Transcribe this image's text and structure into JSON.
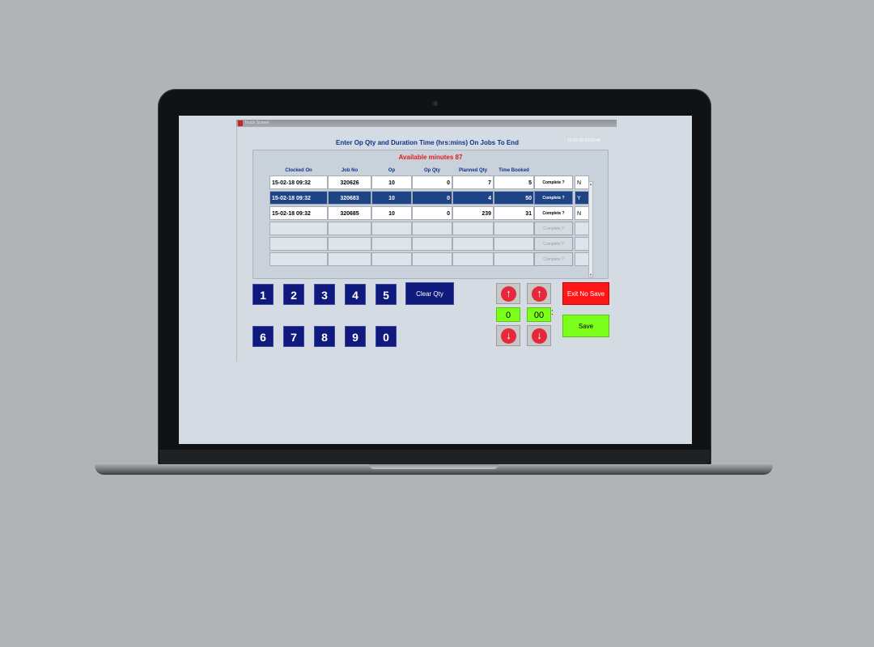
{
  "window": {
    "title": "Touch Screen"
  },
  "header": {
    "title": "Enter Op Qty and Duration Time (hrs:mins) On Jobs To End",
    "datetime": "15-02-18 10:59:46"
  },
  "available": "Available minutes 87",
  "table": {
    "columns": [
      "Clocked On",
      "Job No",
      "Op",
      "Op Qty",
      "Planned Qty",
      "Time Booked"
    ],
    "complete_label": "Complete ?",
    "rows": [
      {
        "clocked_on": "15-02-18 09:32",
        "job_no": "320626",
        "op": "10",
        "op_qty": "0",
        "planned_qty": "7",
        "time_booked": "5",
        "flag": "N"
      },
      {
        "clocked_on": "15-02-18 09:32",
        "job_no": "320683",
        "op": "10",
        "op_qty": "0",
        "planned_qty": "4",
        "time_booked": "50",
        "flag": "Y"
      },
      {
        "clocked_on": "15-02-18 09:32",
        "job_no": "320685",
        "op": "10",
        "op_qty": "0",
        "planned_qty": "239",
        "time_booked": "31",
        "flag": "N"
      }
    ],
    "selected_row": 1
  },
  "keypad": {
    "keys": [
      "1",
      "2",
      "3",
      "4",
      "5",
      "6",
      "7",
      "8",
      "9",
      "0"
    ],
    "clear_label": "Clear Qty"
  },
  "duration": {
    "hours": "0",
    "minutes": "00",
    "separator": ":"
  },
  "actions": {
    "exit_label": "Exit No Save",
    "save_label": "Save"
  },
  "icons": {
    "up": "arrow-up-icon",
    "down": "arrow-down-icon"
  },
  "colors": {
    "accent": "#0f1a7c",
    "selected_row": "#1d4487",
    "exit": "#ff1616",
    "save": "#7dff1c",
    "arrow": "#e5283a",
    "available_text": "#e21b1b"
  }
}
